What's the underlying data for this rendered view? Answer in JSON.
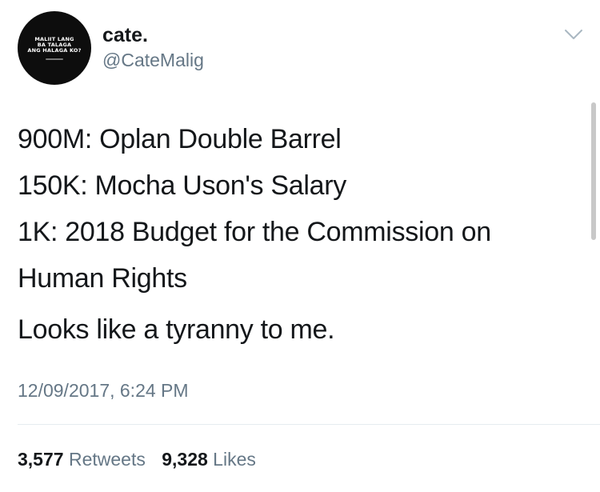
{
  "author": {
    "display_name": "cate.",
    "handle": "@CateMalig",
    "avatar_text": [
      "MALIIT LANG",
      "BA TALAGA",
      "ANG HALAGA KO?"
    ]
  },
  "menu_icon": "chevron-down-icon",
  "tweet": {
    "lines": [
      "900M: Oplan Double Barrel",
      "150K: Mocha Uson's Salary",
      "1K: 2018 Budget for the Commission on",
      "Human Rights"
    ],
    "closing": "Looks like a tyranny to me."
  },
  "timestamp": "12/09/2017, 6:24 PM",
  "stats": {
    "retweets_count": "3,577",
    "retweets_label": "Retweets",
    "likes_count": "9,328",
    "likes_label": "Likes"
  },
  "colors": {
    "text_primary": "#14171a",
    "text_secondary": "#657786",
    "divider": "#e6ecf0",
    "avatar_background": "#0d0d0d"
  }
}
